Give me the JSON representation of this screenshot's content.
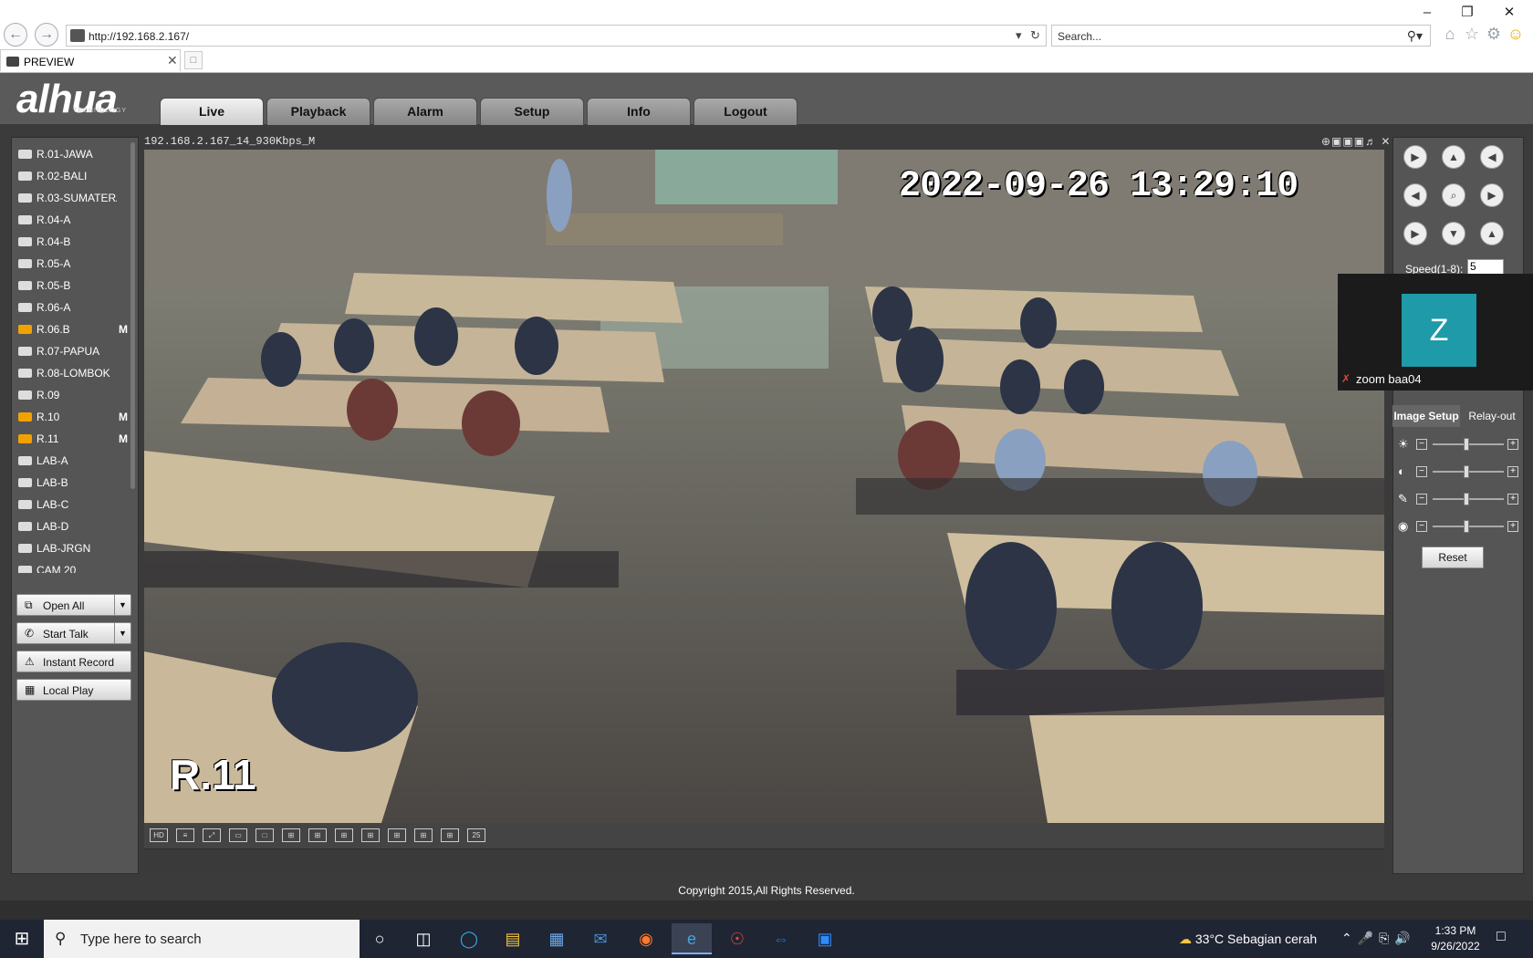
{
  "browser": {
    "url": "http://192.168.2.167/",
    "search_placeholder": "Search...",
    "tab_title": "PREVIEW"
  },
  "app": {
    "logo": "alhua",
    "logo_sub": "TECHNOLOGY",
    "nav": [
      "Live",
      "Playback",
      "Alarm",
      "Setup",
      "Info",
      "Logout"
    ],
    "active_nav": "Live",
    "devices": [
      {
        "name": "R.01-JAWA",
        "rec": false,
        "flag": ""
      },
      {
        "name": "R.02-BALI",
        "rec": false,
        "flag": ""
      },
      {
        "name": "R.03-SUMATERA",
        "rec": false,
        "flag": ""
      },
      {
        "name": "R.04-A",
        "rec": false,
        "flag": ""
      },
      {
        "name": "R.04-B",
        "rec": false,
        "flag": ""
      },
      {
        "name": "R.05-A",
        "rec": false,
        "flag": ""
      },
      {
        "name": "R.05-B",
        "rec": false,
        "flag": ""
      },
      {
        "name": "R.06-A",
        "rec": false,
        "flag": ""
      },
      {
        "name": "R.06.B",
        "rec": true,
        "flag": "M"
      },
      {
        "name": "R.07-PAPUA",
        "rec": false,
        "flag": ""
      },
      {
        "name": "R.08-LOMBOK",
        "rec": false,
        "flag": ""
      },
      {
        "name": "R.09",
        "rec": false,
        "flag": ""
      },
      {
        "name": "R.10",
        "rec": true,
        "flag": "M"
      },
      {
        "name": "R.11",
        "rec": true,
        "flag": "M"
      },
      {
        "name": "LAB-A",
        "rec": false,
        "flag": ""
      },
      {
        "name": "LAB-B",
        "rec": false,
        "flag": ""
      },
      {
        "name": "LAB-C",
        "rec": false,
        "flag": ""
      },
      {
        "name": "LAB-D",
        "rec": false,
        "flag": ""
      },
      {
        "name": "LAB-JRGN",
        "rec": false,
        "flag": ""
      },
      {
        "name": "CAM 20",
        "rec": false,
        "flag": ""
      }
    ],
    "buttons": {
      "open_all": "Open All",
      "start_talk": "Start Talk",
      "instant_record": "Instant Record",
      "local_play": "Local Play"
    },
    "video_label": "192.168.2.167_14_930Kbps_M",
    "timestamp": "2022-09-26 13:29:10",
    "camera_name": "R.11",
    "view_buttons": [
      "HD",
      "≡",
      "⤢",
      "▭",
      "□",
      "⊞",
      "⊞",
      "⊞",
      "⊞",
      "⊞",
      "⊞",
      "⊞",
      "25"
    ],
    "ptz": {
      "speed_label": "Speed(1-8):",
      "speed_value": "5"
    },
    "image_setup_tab": "Image Setup",
    "relay_tab": "Relay-out",
    "reset": "Reset",
    "copyright": "Copyright 2015,All Rights Reserved."
  },
  "zoom_overlay": {
    "avatar_letter": "Z",
    "name": "zoom baa04"
  },
  "taskbar": {
    "search_placeholder": "Type here to search",
    "weather": "33°C  Sebagian cerah",
    "time": "1:33 PM",
    "date": "9/26/2022"
  }
}
